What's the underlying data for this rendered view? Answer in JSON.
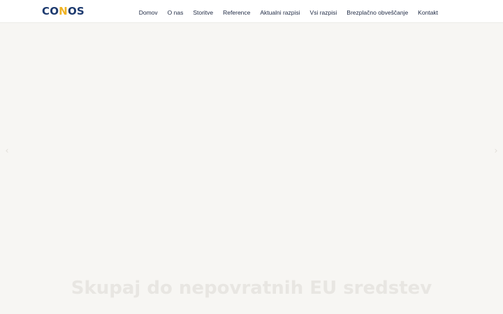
{
  "brand": {
    "logo_pre": "CO",
    "logo_accent": "N",
    "logo_post": "OS",
    "accent_color": "#f0b323",
    "primary_color": "#1d3a6f"
  },
  "nav": {
    "items": [
      {
        "label": "Domov"
      },
      {
        "label": "O nas"
      },
      {
        "label": "Storitve"
      },
      {
        "label": "Reference"
      },
      {
        "label": "Aktualni razpisi"
      },
      {
        "label": "Vsi razpisi"
      },
      {
        "label": "Brezplačno obveščanje"
      },
      {
        "label": "Kontakt"
      }
    ]
  },
  "hero": {
    "headline": "Skupaj do nepovratnih EU sredstev",
    "prev_icon": "‹",
    "next_icon": "›",
    "background_color": "#f7f6f3"
  }
}
